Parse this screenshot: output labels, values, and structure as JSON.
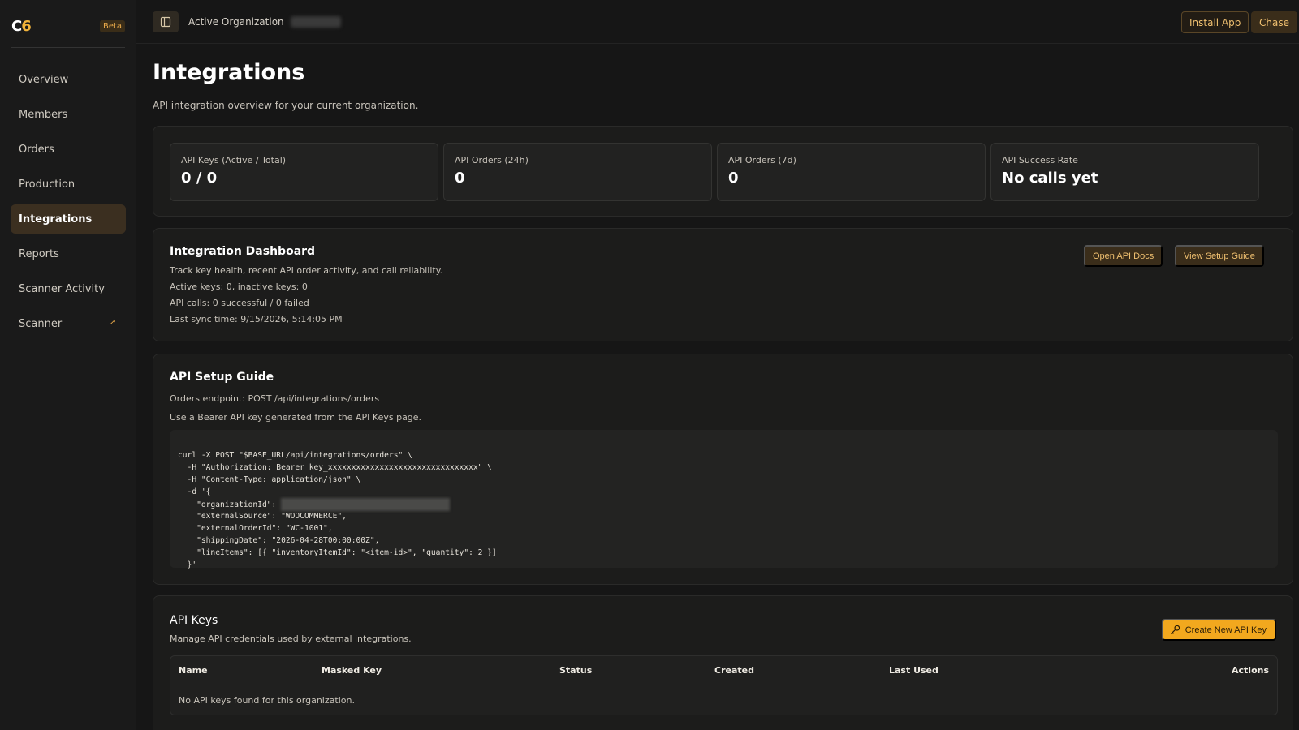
{
  "brand": {
    "logo_text": "C",
    "logo_accent": "6",
    "badge": "Beta"
  },
  "sidebar": {
    "items": [
      {
        "label": "Overview"
      },
      {
        "label": "Members"
      },
      {
        "label": "Orders"
      },
      {
        "label": "Production"
      },
      {
        "label": "Integrations",
        "active": true
      },
      {
        "label": "Reports"
      },
      {
        "label": "Scanner Activity"
      },
      {
        "label": "Scanner",
        "external": true,
        "icon": "external-link-icon"
      }
    ]
  },
  "topbar": {
    "org_label": "Active Organization",
    "install_label": "Install App",
    "user_label": "Chase"
  },
  "page": {
    "title": "Integrations",
    "subtitle": "API integration overview for your current organization."
  },
  "stats": [
    {
      "label": "API Keys (Active / Total)",
      "value": "0 / 0"
    },
    {
      "label": "API Orders (24h)",
      "value": "0"
    },
    {
      "label": "API Orders (7d)",
      "value": "0"
    },
    {
      "label": "API Success Rate",
      "value": "No calls yet"
    }
  ],
  "dashboard": {
    "title": "Integration Dashboard",
    "description": "Track key health, recent API order activity, and call reliability.",
    "keys_line": "Active keys: 0, inactive keys: 0",
    "calls_line": "API calls: 0 successful / 0 failed",
    "sync_line": "Last sync time: 9/15/2026, 5:14:05 PM",
    "docs_button": "Open API Docs",
    "guide_button": "View Setup Guide"
  },
  "guide": {
    "title": "API Setup Guide",
    "endpoint_line": "Orders endpoint: POST /api/integrations/orders",
    "auth_line": "Use a Bearer API key generated from the API Keys page.",
    "code": {
      "line1": "curl -X POST \"$BASE_URL/api/integrations/orders\" \\",
      "line2": "  -H \"Authorization: Bearer key_xxxxxxxxxxxxxxxxxxxxxxxxxxxxxxxx\" \\",
      "line3": "  -H \"Content-Type: application/json\" \\",
      "line4": "  -d '{",
      "line5_prefix": "    \"organizationId\": ",
      "line6": "    \"externalSource\": \"WOOCOMMERCE\",",
      "line7": "    \"externalOrderId\": \"WC-1001\",",
      "line8": "    \"shippingDate\": \"2026-04-28T00:00:00Z\",",
      "line9": "    \"lineItems\": [{ \"inventoryItemId\": \"<item-id>\", \"quantity\": 2 }]",
      "line10": "  }'"
    }
  },
  "api_keys": {
    "title": "API Keys",
    "description": "Manage API credentials used by external integrations.",
    "create_button": "Create New API Key",
    "columns": [
      "Name",
      "Masked Key",
      "Status",
      "Created",
      "Last Used",
      "Actions"
    ],
    "empty_text": "No API keys found for this organization."
  },
  "colors": {
    "accent": "#f2a81e",
    "background": "#161616",
    "panel": "#1c1c1b"
  }
}
